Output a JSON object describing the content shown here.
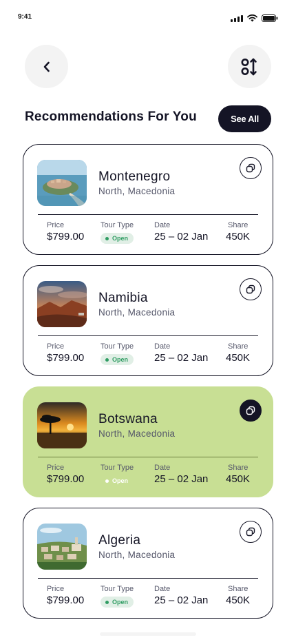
{
  "status_bar": {
    "time": "9:41"
  },
  "header": {
    "back_icon": "chevron-left-icon",
    "sort_icon": "sort-order-icon",
    "section_title": "Recommendations For You",
    "see_all_label": "See All"
  },
  "labels": {
    "price": "Price",
    "tour_type": "Tour Type",
    "date": "Date",
    "share": "Share"
  },
  "cards": [
    {
      "name": "Montenegro",
      "location": "North, Macedonia",
      "price": "$799.00",
      "tour_type": "Open",
      "date": "25 – 02 Jan",
      "share": "450K",
      "active": false
    },
    {
      "name": "Namibia",
      "location": "North, Macedonia",
      "price": "$799.00",
      "tour_type": "Open",
      "date": "25 – 02 Jan",
      "share": "450K",
      "active": false
    },
    {
      "name": "Botswana",
      "location": "North, Macedonia",
      "price": "$799.00",
      "tour_type": "Open",
      "date": "25 – 02 Jan",
      "share": "450K",
      "active": true
    },
    {
      "name": "Algeria",
      "location": "North, Macedonia",
      "price": "$799.00",
      "tour_type": "Open",
      "date": "25 – 02 Jan",
      "share": "450K",
      "active": false
    }
  ],
  "colors": {
    "dark": "#141425",
    "active_card": "#c8df94",
    "badge_bg": "#e1efe6",
    "badge_text": "#2f9c62"
  }
}
